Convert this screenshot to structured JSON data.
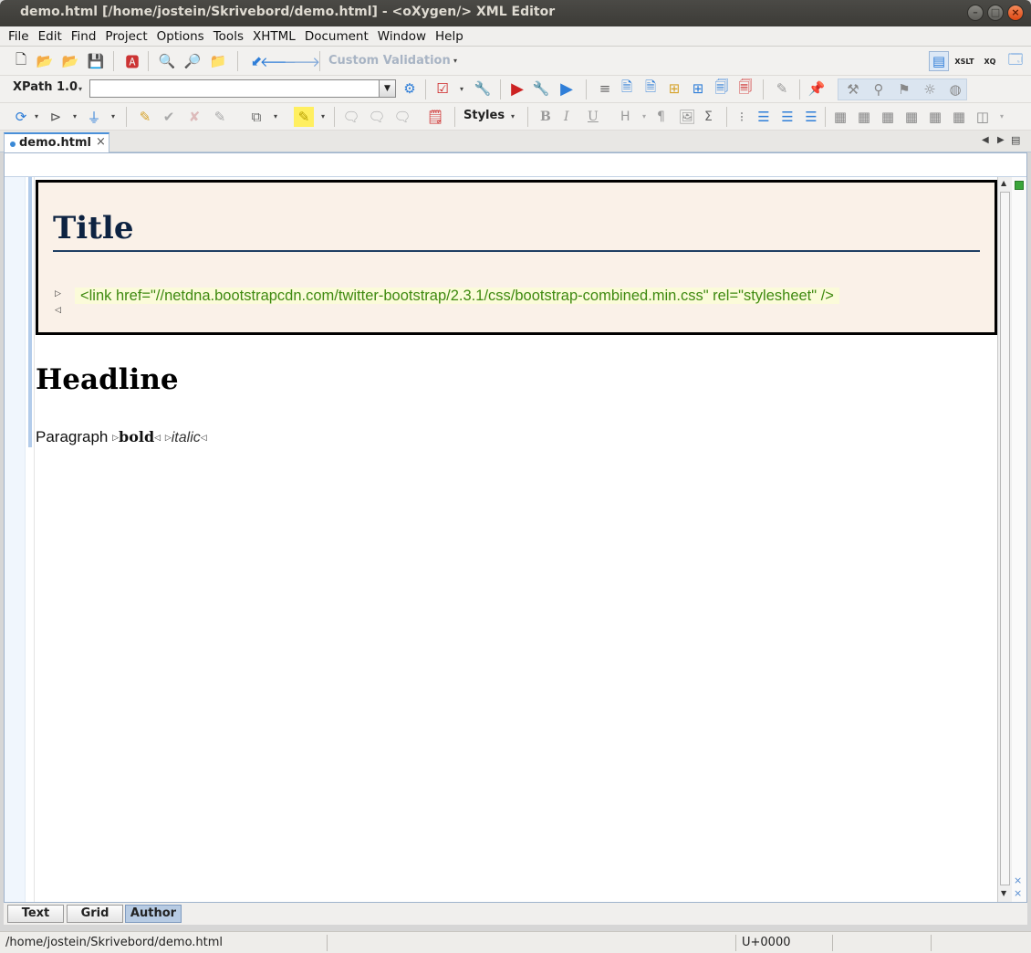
{
  "window": {
    "title": "demo.html [/home/jostein/Skrivebord/demo.html] - <oXygen/> XML Editor"
  },
  "menu": [
    "File",
    "Edit",
    "Find",
    "Project",
    "Options",
    "Tools",
    "XHTML",
    "Document",
    "Window",
    "Help"
  ],
  "toolbar": {
    "custom_validation": "Custom Validation",
    "xpath_label": "XPath 1.0",
    "xpath_value": "",
    "styles_label": "Styles",
    "format_bold": "B",
    "format_italic": "I",
    "format_underline": "U",
    "format_heading": "H",
    "format_pilcrow": "¶",
    "format_sigma": "Σ"
  },
  "editor_tab": {
    "label": "demo.html",
    "close": "×"
  },
  "document": {
    "title": "Title",
    "link_element": "<link href=\"//netdna.bootstrapcdn.com/twitter-bootstrap/2.3.1/css/bootstrap-combined.min.css\" rel=\"stylesheet\" />",
    "headline": "Headline",
    "paragraph_text": "Paragraph",
    "bold_text": "bold",
    "italic_text": "italic"
  },
  "mode_tabs": [
    "Text",
    "Grid",
    "Author"
  ],
  "active_mode": "Author",
  "status": {
    "path": "/home/jostein/Skrivebord/demo.html",
    "unicode": "U+0000"
  }
}
